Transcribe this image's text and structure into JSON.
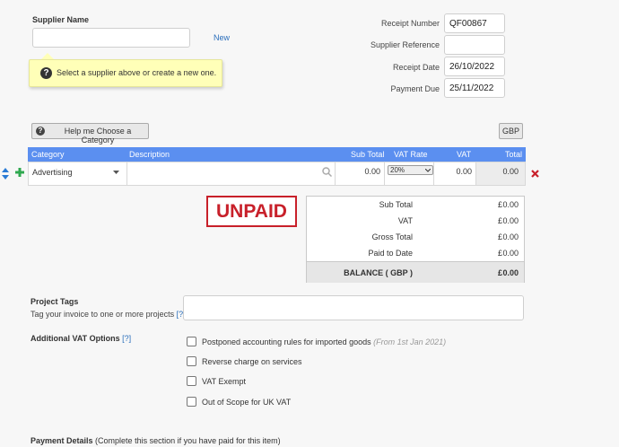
{
  "supplier": {
    "label": "Supplier Name",
    "value": "",
    "new_link": "New",
    "hint": "Select a supplier above or create a new one."
  },
  "receipt": {
    "number_label": "Receipt Number",
    "number": "QF00867",
    "supplier_ref_label": "Supplier Reference",
    "supplier_ref": "",
    "date_label": "Receipt Date",
    "date": "26/10/2022",
    "payment_due_label": "Payment Due",
    "payment_due": "25/11/2022"
  },
  "toolbar": {
    "help_label": "Help me Choose a Category",
    "currency_label": "GBP"
  },
  "table": {
    "headers": {
      "category": "Category",
      "description": "Description",
      "subtotal": "Sub Total",
      "vat_rate": "VAT Rate",
      "vat": "VAT",
      "total": "Total"
    },
    "row": {
      "category": "Advertising",
      "description": "",
      "subtotal": "0.00",
      "vat_rate": "20%",
      "vat": "0.00",
      "total": "0.00"
    }
  },
  "status": {
    "label": "UNPAID"
  },
  "summary": {
    "currency_symbol": "£",
    "rows": [
      {
        "label": "Sub Total",
        "value": "0.00"
      },
      {
        "label": "VAT",
        "value": "0.00"
      },
      {
        "label": "Gross Total",
        "value": "0.00"
      },
      {
        "label": "Paid to Date",
        "value": "0.00"
      }
    ],
    "balance_label": "BALANCE ( GBP )",
    "balance_value": "0.00"
  },
  "project_tags": {
    "title": "Project Tags",
    "desc": "Tag your invoice to one or more projects",
    "help_link": "[?]",
    "period": ".",
    "value": ""
  },
  "vat_options": {
    "title": "Additional VAT Options",
    "help_link": "[?]",
    "options": [
      {
        "label": "Postponed accounting rules for imported goods",
        "note": "(From 1st Jan 2021)"
      },
      {
        "label": "Reverse charge on services",
        "note": ""
      },
      {
        "label": "VAT Exempt",
        "note": ""
      },
      {
        "label": "Out of Scope for UK VAT",
        "note": ""
      }
    ]
  },
  "payment_details": {
    "title": "Payment Details",
    "note": "(Complete this section if you have paid for this item)"
  }
}
